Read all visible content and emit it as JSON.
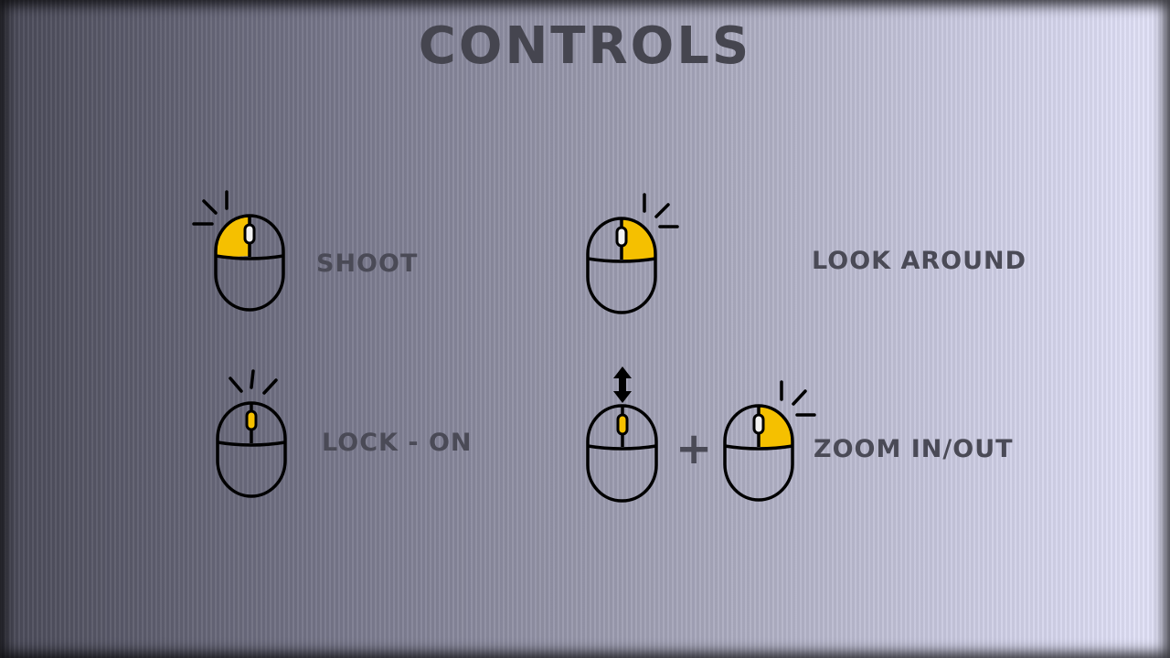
{
  "title": "CONTROLS",
  "accent_color": "#f5c000",
  "controls": [
    {
      "label": "SHOOT",
      "icon": "mouse-left-click-icon"
    },
    {
      "label": "LOOK AROUND",
      "icon": "mouse-right-click-icon"
    },
    {
      "label": "LOCK - ON",
      "icon": "mouse-wheel-click-icon"
    },
    {
      "label": "ZOOM IN/OUT",
      "icon": "mouse-scroll-icon",
      "modifier": "+",
      "modifier_icon": "mouse-right-click-icon"
    }
  ]
}
